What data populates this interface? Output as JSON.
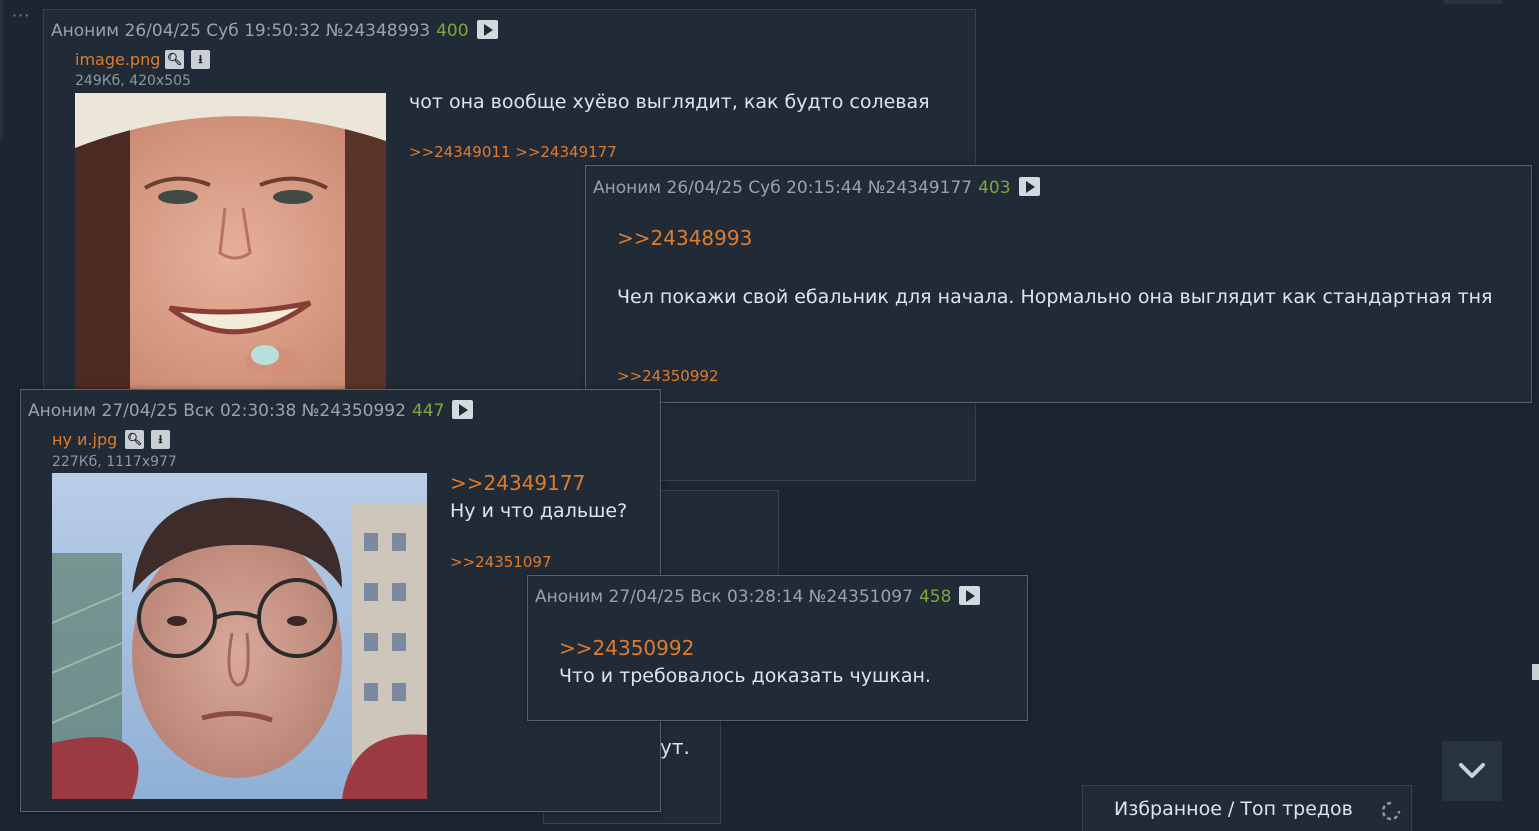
{
  "posts": [
    {
      "header": "Аноним 26/04/25 Суб 19:50:32 №24348993",
      "rating": "400",
      "file": {
        "name": "image.png",
        "meta": "249Кб, 420x505"
      },
      "message": "чот она вообще хуёво выглядит, как будто солевая",
      "replies": ">>24349011 >>24349177"
    },
    {
      "header": "Аноним 26/04/25 Суб 20:15:44 №24349177",
      "rating": "403",
      "quote": ">>24348993",
      "message": "Чел покажи свой ебальник для начала. Нормально она выглядит как стандартная тня",
      "replies": ">>24350992"
    },
    {
      "header": "Аноним 27/04/25 Вск 02:30:38 №24350992",
      "rating": "447",
      "file": {
        "name": "ну и.jpg",
        "meta": "227Кб, 1117x977"
      },
      "quote": ">>24349177",
      "message": "Ну и что дальше?",
      "replies": ">>24351097"
    },
    {
      "header": "Аноним 27/04/25 Вск 03:28:14 №24351097",
      "rating": "458",
      "quote": ">>24350992",
      "message": "Что и требовалось доказать чушкан."
    }
  ],
  "background_fragment": "ут.",
  "bottom_bar": {
    "label": "Избранное / Топ тредов"
  },
  "dots": "···",
  "icons": {
    "search": "search-icon",
    "download": "download-icon",
    "play": "play-icon",
    "scroll_down": "chevron-down-icon",
    "refresh": "refresh-icon"
  },
  "colors": {
    "link": "#e07b2c",
    "rating": "#7fa63a",
    "background": "#1c2530",
    "post": "#212b37"
  }
}
